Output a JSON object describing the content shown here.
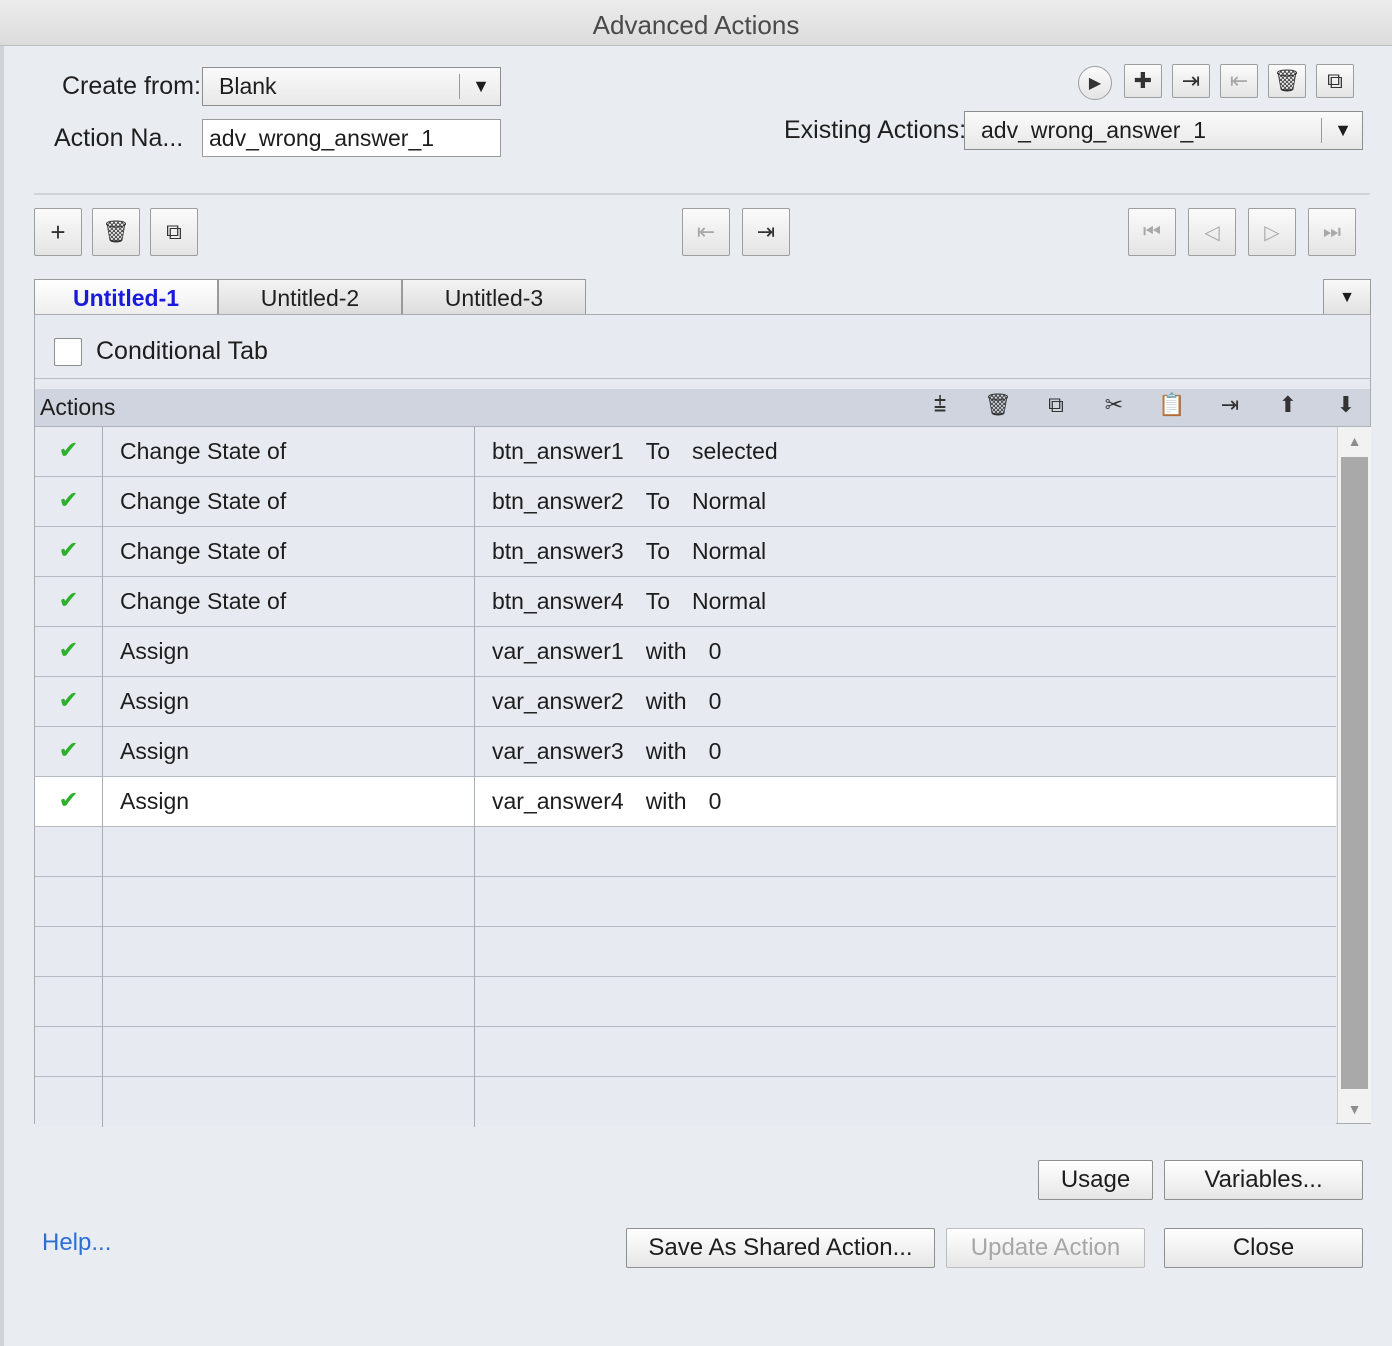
{
  "window": {
    "title": "Advanced Actions"
  },
  "form": {
    "create_from_label": "Create from:",
    "create_from_value": "Blank",
    "action_name_label": "Action Na...",
    "action_name_value": "adv_wrong_answer_1",
    "existing_actions_label": "Existing Actions:",
    "existing_actions_value": "adv_wrong_answer_1"
  },
  "tabs": [
    {
      "label": "Untitled-1",
      "active": true
    },
    {
      "label": "Untitled-2",
      "active": false
    },
    {
      "label": "Untitled-3",
      "active": false
    }
  ],
  "conditional": {
    "label": "Conditional Tab",
    "checked": false
  },
  "actions": {
    "header": "Actions",
    "rows": [
      {
        "status": "✔",
        "action": "Change State of",
        "target": "btn_answer1",
        "op": "To",
        "value": "selected"
      },
      {
        "status": "✔",
        "action": "Change State of",
        "target": "btn_answer2",
        "op": "To",
        "value": "Normal"
      },
      {
        "status": "✔",
        "action": "Change State of",
        "target": "btn_answer3",
        "op": "To",
        "value": "Normal"
      },
      {
        "status": "✔",
        "action": "Change State of",
        "target": "btn_answer4",
        "op": "To",
        "value": "Normal"
      },
      {
        "status": "✔",
        "action": "Assign",
        "target": "var_answer1",
        "op": "with",
        "value": "0"
      },
      {
        "status": "✔",
        "action": "Assign",
        "target": "var_answer2",
        "op": "with",
        "value": "0"
      },
      {
        "status": "✔",
        "action": "Assign",
        "target": "var_answer3",
        "op": "with",
        "value": "0"
      },
      {
        "status": "✔",
        "action": "Assign",
        "target": "var_answer4",
        "op": "with",
        "value": "0"
      }
    ]
  },
  "buttons": {
    "usage": "Usage",
    "variables": "Variables...",
    "save_shared": "Save As Shared Action...",
    "update_action": "Update Action",
    "close": "Close",
    "help": "Help..."
  },
  "icons": {
    "play": "play-icon",
    "add": "plus-icon",
    "import": "import-icon",
    "export": "export-icon",
    "delete": "trash-icon",
    "duplicate": "duplicate-icon"
  }
}
